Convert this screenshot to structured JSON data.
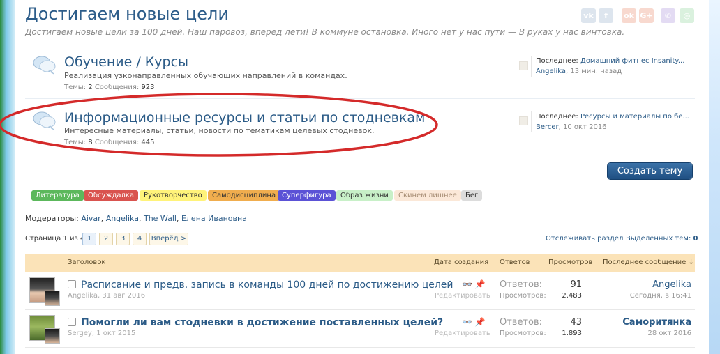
{
  "header": {
    "title": "Достигаем новые цели",
    "description": "Достигаем новые цели за 100 дней. Наш паровоз, вперед лети! В коммуне остановка. Иного нет у нас пути — В руках у нас винтовка."
  },
  "share": [
    {
      "icon": "vk-icon",
      "label": "vk",
      "color": "#dde5ee"
    },
    {
      "icon": "facebook-icon",
      "label": "f",
      "color": "#dde5ee"
    },
    {
      "icon": "odnoklassniki-icon",
      "label": "ok",
      "color": "#f8d9cf"
    },
    {
      "icon": "google-plus-icon",
      "label": "G+",
      "color": "#f8d9cf"
    },
    {
      "icon": "viber-icon",
      "label": "✆",
      "color": "#e3dbf3"
    },
    {
      "icon": "whatsapp-icon",
      "label": "◎",
      "color": "#daf1de"
    }
  ],
  "forums": [
    {
      "title": "Обучение / Курсы",
      "desc": "Реализация узконаправленных обучающих направлений в командах.",
      "stats_threads_label": "Темы:",
      "stats_threads": "2",
      "stats_msgs_label": "Сообщения:",
      "stats_msgs": "923",
      "last_label": "Последнее:",
      "last_title": "Домашний фитнес Insanity...",
      "last_user": "Angelika",
      "last_time": ", 13 мин. назад"
    },
    {
      "title": "Информационные ресурсы и статьи по стодневкам",
      "desc": "Интересные материалы, статьи, новости по тематикам целевых стодневок.",
      "stats_threads_label": "Темы:",
      "stats_threads": "8",
      "stats_msgs_label": "Сообщения:",
      "stats_msgs": "445",
      "last_label": "Последнее:",
      "last_title": "Ресурсы и материалы по бе...",
      "last_user": "Bercer",
      "last_time": ", 10 окт 2016"
    }
  ],
  "create_button": "Создать тему",
  "prefixes": [
    {
      "label": "Литература",
      "bg": "#5cb85c",
      "fg": "#ffffff"
    },
    {
      "label": "Обсуждалка",
      "bg": "#d9534f",
      "fg": "#ffffff"
    },
    {
      "label": "Рукотворчество",
      "bg": "#fff37a",
      "fg": "#333333"
    },
    {
      "label": "Самодисциплина",
      "bg": "#f0ad4e",
      "fg": "#333333"
    },
    {
      "label": "Суперфигура",
      "bg": "#5b52d6",
      "fg": "#ffffff"
    },
    {
      "label": "Образ жизни",
      "bg": "#c8f0c8",
      "fg": "#333333"
    },
    {
      "label": "Скинем лишнее",
      "bg": "#fbe8d8",
      "fg": "#a58b72"
    },
    {
      "label": "Бег",
      "bg": "#dcdcdc",
      "fg": "#333333"
    }
  ],
  "moderators": {
    "label": "Модераторы:",
    "names": [
      "Aivar",
      "Angelika",
      "The Wall",
      "Елена Ивановна"
    ]
  },
  "pagination": {
    "label": "Страница 1 из 4",
    "pages": [
      "1",
      "2",
      "3",
      "4"
    ],
    "next": "Вперёд >"
  },
  "watch_link": "Отслеживать раздел",
  "watched": {
    "label": "Выделенных тем:",
    "count": "0"
  },
  "table": {
    "headers": {
      "title": "Заголовок",
      "created": "Дата создания",
      "replies": "Ответов",
      "views": "Просмотров",
      "last": "Последнее сообщение ↓"
    },
    "rows": [
      {
        "title": "Расписание и предв. запись в команды 100 дней по достижению целей",
        "bold": false,
        "author": "Angelika",
        "date": ", 31 авг 2016",
        "edit": "Редактировать",
        "replies_label": "Ответов:",
        "replies": "91",
        "views_label": "Просмотров:",
        "views": "2.483",
        "last_user": "Angelika",
        "last_date": "Сегодня, в 16:41"
      },
      {
        "title": "Помогли ли вам стодневки в достижение поставленных целей?",
        "bold": true,
        "author": "Sergey",
        "date": ", 1 окт 2015",
        "edit": "Редактировать",
        "replies_label": "Ответов:",
        "replies": "43",
        "views_label": "Просмотров:",
        "views": "1.893",
        "last_user": "Саморитянка",
        "last_date": "28 окт 2016"
      }
    ]
  },
  "colors": {
    "accent": "#2b5b87",
    "annotation": "#d42a2a",
    "table_header": "#fbe3b8"
  }
}
